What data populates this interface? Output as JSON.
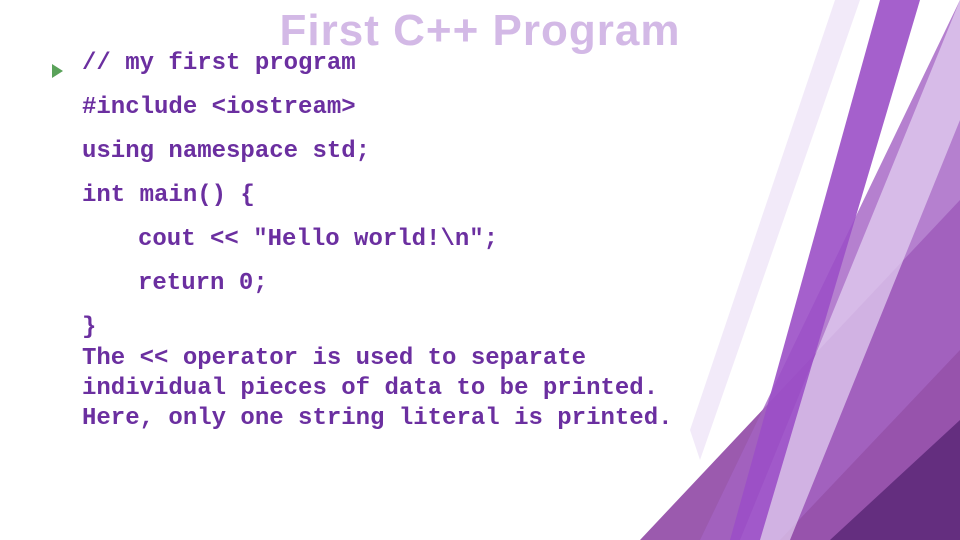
{
  "slide": {
    "title": "First C++ Program",
    "code": {
      "l1": "// my first program",
      "l2": "#include <iostream>",
      "l3": "using namespace std;",
      "l4": "int main() {",
      "l5": "cout << \"Hello world!\\n\";",
      "l6": "return 0;",
      "l7": "}"
    },
    "explain": "The << operator is used to separate individual pieces of data to be printed. Here, only one string literal is printed."
  },
  "colors": {
    "title": "#d3b9e6",
    "text": "#6b2fa0",
    "bullet": "#5aa25a"
  }
}
